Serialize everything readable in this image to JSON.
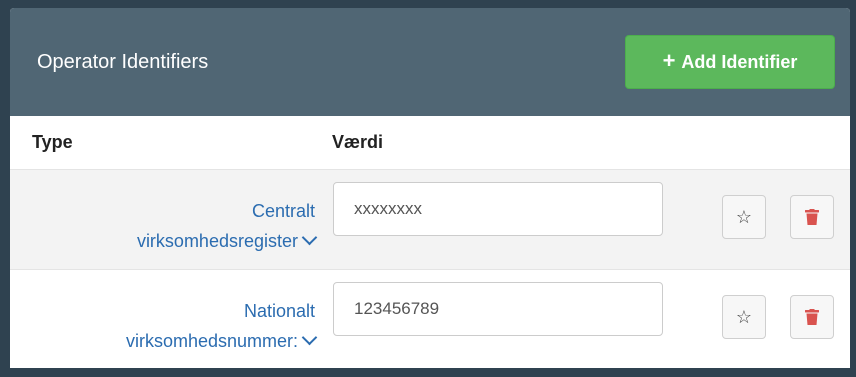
{
  "header": {
    "title": "Operator Identifiers",
    "add_button_label": "Add Identifier",
    "add_button_icon": "plus-icon"
  },
  "table": {
    "columns": {
      "type": "Type",
      "value": "Værdi"
    },
    "rows": [
      {
        "type_line1": "Centralt",
        "type_line2": "virksomhedsregister",
        "value": "xxxxxxxx"
      },
      {
        "type_line1": "Nationalt",
        "type_line2": "virksomhedsnummer:",
        "value": "123456789"
      }
    ]
  },
  "colors": {
    "header_bg": "#506674",
    "add_button": "#5cb85c",
    "link": "#2b6cb0",
    "delete_icon": "#d9534f"
  }
}
